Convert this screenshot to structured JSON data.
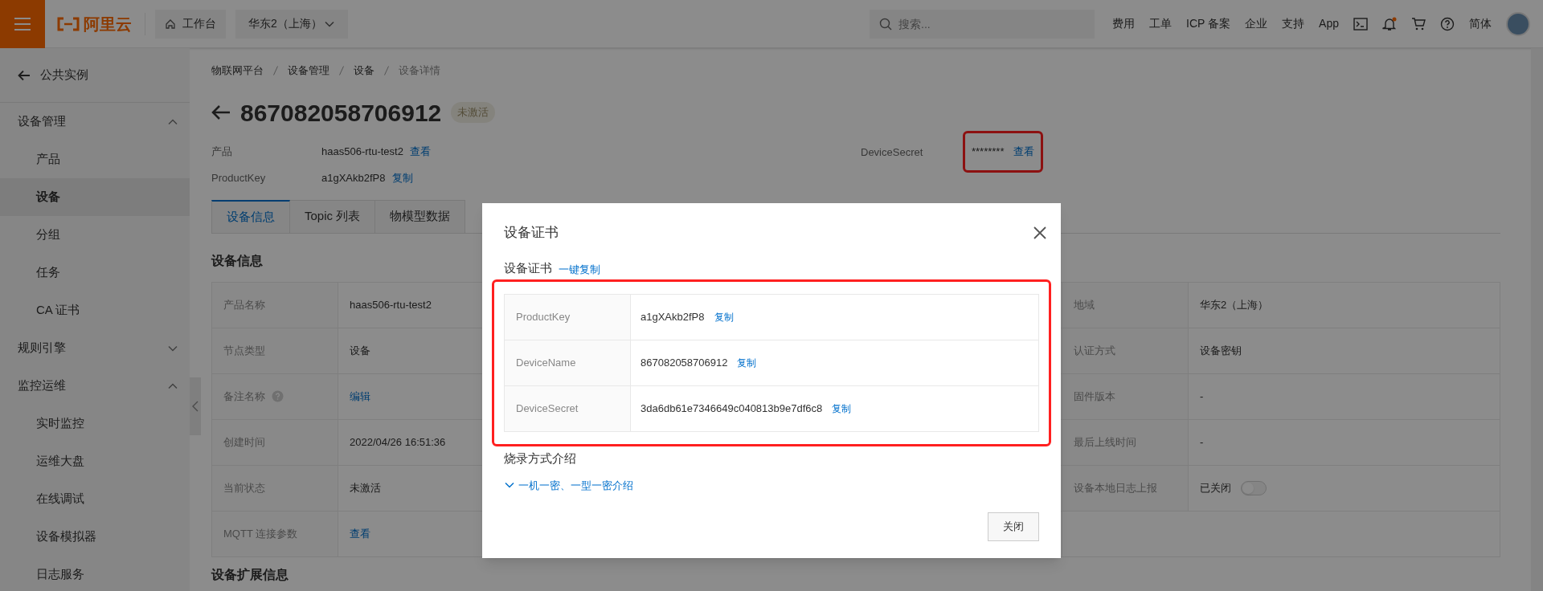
{
  "topbar": {
    "logo": "阿里云",
    "workbench": "工作台",
    "region": "华东2（上海）",
    "search": {
      "placeholder": "搜索..."
    },
    "links": [
      "费用",
      "工单",
      "ICP 备案",
      "企业",
      "支持",
      "App"
    ],
    "has_unread": true,
    "language": "简体"
  },
  "sidebar": {
    "back": "公共实例",
    "items": [
      {
        "label": "设备管理",
        "expanded": true,
        "children": [
          {
            "label": "产品",
            "selected": false
          },
          {
            "label": "设备",
            "selected": true
          },
          {
            "label": "分组",
            "selected": false
          },
          {
            "label": "任务",
            "selected": false
          },
          {
            "label": "CA 证书",
            "selected": false
          }
        ]
      },
      {
        "label": "规则引擎",
        "expanded": false
      },
      {
        "label": "监控运维",
        "expanded": true,
        "children": [
          {
            "label": "实时监控",
            "selected": false
          },
          {
            "label": "运维大盘",
            "selected": false
          },
          {
            "label": "在线调试",
            "selected": false
          },
          {
            "label": "设备模拟器",
            "selected": false
          },
          {
            "label": "日志服务",
            "selected": false
          }
        ]
      }
    ]
  },
  "breadcrumb": [
    "物联网平台",
    "设备管理",
    "设备",
    "设备详情"
  ],
  "device": {
    "title": "867082058706912",
    "status": "未激活",
    "fields": [
      {
        "label": "产品",
        "value": "haas506-rtu-test2",
        "action": "查看"
      },
      {
        "label": "ProductKey",
        "value": "a1gXAkb2fP8",
        "action": "复制"
      }
    ],
    "secret": {
      "label": "DeviceSecret",
      "value": "********",
      "action": "查看",
      "highlighted": true
    }
  },
  "tabs": [
    {
      "label": "设备信息",
      "selected": true
    },
    {
      "label": "Topic 列表",
      "selected": false
    },
    {
      "label": "物模型数据",
      "selected": false
    }
  ],
  "info": {
    "title": "设备信息",
    "left": [
      {
        "label": "产品名称",
        "value": "haas506-rtu-test2",
        "kind": "text"
      },
      {
        "label": "节点类型",
        "value": "设备",
        "kind": "text"
      },
      {
        "label": "备注名称",
        "value": "编辑",
        "kind": "link",
        "help": true
      },
      {
        "label": "创建时间",
        "value": "2022/04/26 16:51:36",
        "kind": "text"
      },
      {
        "label": "当前状态",
        "value": "未激活",
        "kind": "text"
      },
      {
        "label": "MQTT 连接参数",
        "value": "查看",
        "kind": "link"
      }
    ],
    "right": [
      {
        "label": "地域",
        "value": "华东2（上海）",
        "kind": "text"
      },
      {
        "label": "认证方式",
        "value": "设备密钥",
        "kind": "text"
      },
      {
        "label": "固件版本",
        "value": "-",
        "kind": "text"
      },
      {
        "label": "最后上线时间",
        "value": "-",
        "kind": "text"
      },
      {
        "label": "设备本地日志上报",
        "value": "已关闭",
        "kind": "switch",
        "on": false
      }
    ]
  },
  "extension_title": "设备扩展信息",
  "dialog": {
    "title": "设备证书",
    "section": "设备证书",
    "copy_all": "一键复制",
    "highlighted": true,
    "rows": [
      {
        "label": "ProductKey",
        "value": "a1gXAkb2fP8",
        "action": "复制"
      },
      {
        "label": "DeviceName",
        "value": "867082058706912",
        "action": "复制"
      },
      {
        "label": "DeviceSecret",
        "value": "3da6db61e7346649c040813b9e7df6c8",
        "action": "复制"
      }
    ],
    "intro_title": "烧录方式介绍",
    "intro_link": "一机一密、一型一密介绍",
    "intro_expanded": false,
    "close_button": "关闭"
  }
}
